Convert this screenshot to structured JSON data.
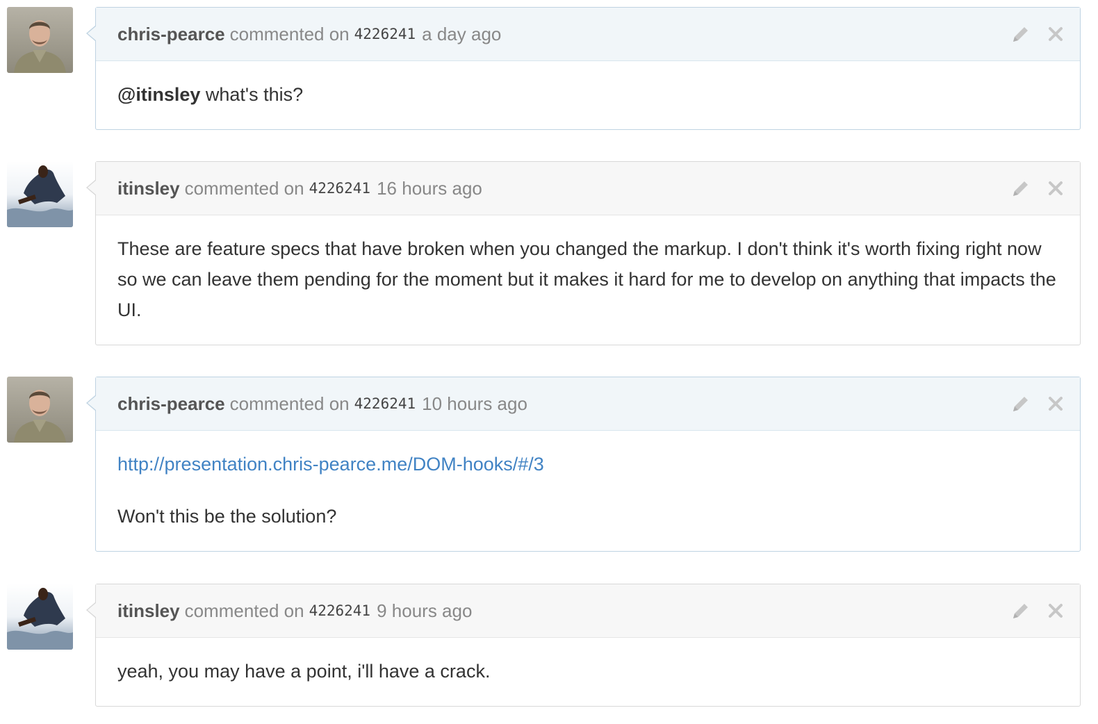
{
  "comments": [
    {
      "author": "chris-pearce",
      "verb": "commented on",
      "commit": "4226241",
      "time": "a day ago",
      "mention": "@itinsley",
      "text": "what's this?"
    },
    {
      "author": "itinsley",
      "verb": "commented on",
      "commit": "4226241",
      "time": "16 hours ago",
      "text": "These are feature specs that have broken when you changed the markup. I don't think it's worth fixing right now so we can leave them pending for the moment but it makes it hard for me to develop on anything that impacts the UI."
    },
    {
      "author": "chris-pearce",
      "verb": "commented on",
      "commit": "4226241",
      "time": "10 hours ago",
      "link": "http://presentation.chris-pearce.me/DOM-hooks/#/3",
      "text": "Won't this be the solution?"
    },
    {
      "author": "itinsley",
      "verb": "commented on",
      "commit": "4226241",
      "time": "9 hours ago",
      "text": "yeah, you may have a point, i'll have a crack."
    }
  ],
  "icons": {
    "edit": "pencil-icon",
    "delete": "close-icon"
  },
  "colors": {
    "link": "#4183c4",
    "owner_header": "#f1f6f9",
    "header": "#f7f7f7"
  }
}
